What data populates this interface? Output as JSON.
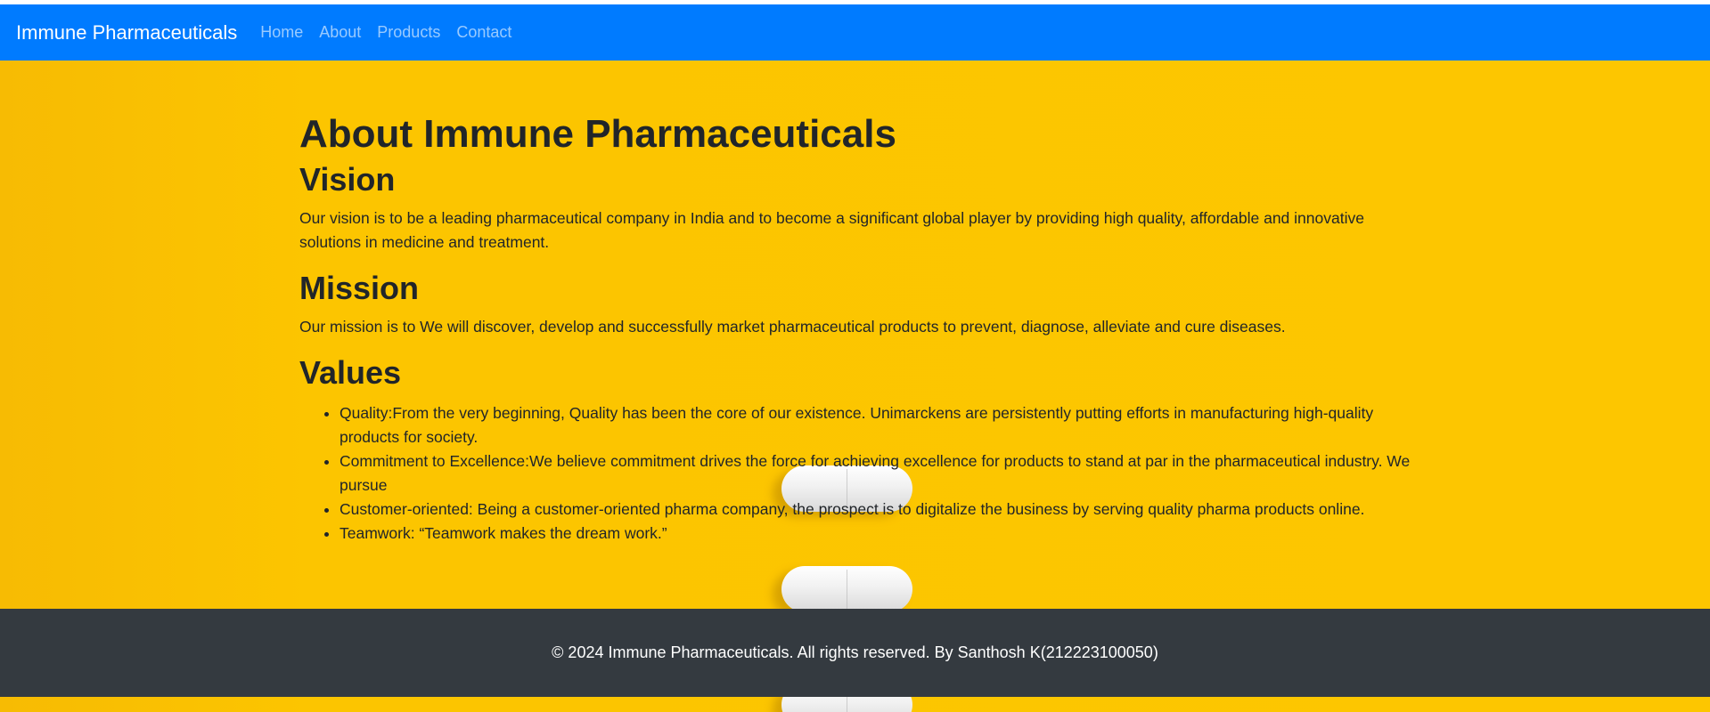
{
  "navbar": {
    "brand": "Immune Pharmaceuticals",
    "links": [
      "Home",
      "About",
      "Products",
      "Contact"
    ],
    "background": "#007bff"
  },
  "page": {
    "background": "#fcc400",
    "title": "About Immune Pharmaceuticals"
  },
  "vision": {
    "heading": "Vision",
    "text": "Our vision is to be a leading pharmaceutical company in India and to become a significant global player by providing high quality, affordable and innovative solutions in medicine and treatment."
  },
  "mission": {
    "heading": "Mission",
    "text": "Our mission is to We will discover, develop and successfully market pharmaceutical products to prevent, diagnose, alleviate and cure diseases."
  },
  "values": {
    "heading": "Values",
    "items": [
      "Quality:From the very beginning, Quality has been the core of our existence. Unimarckens are persistently putting efforts in manufacturing high-quality products for society.",
      "Commitment to Excellence:We believe commitment drives the force for achieving excellence for products to stand at par in the pharmaceutical industry. We pursue",
      "Customer-oriented: Being a customer-oriented pharma company, the prospect is to digitalize the business by serving quality pharma products online.",
      "Teamwork: “Teamwork makes the dream work.”"
    ]
  },
  "footer": {
    "text": "© 2024 Immune Pharmaceuticals. All rights reserved. By Santhosh K(212223100050)",
    "background": "#343a40"
  }
}
